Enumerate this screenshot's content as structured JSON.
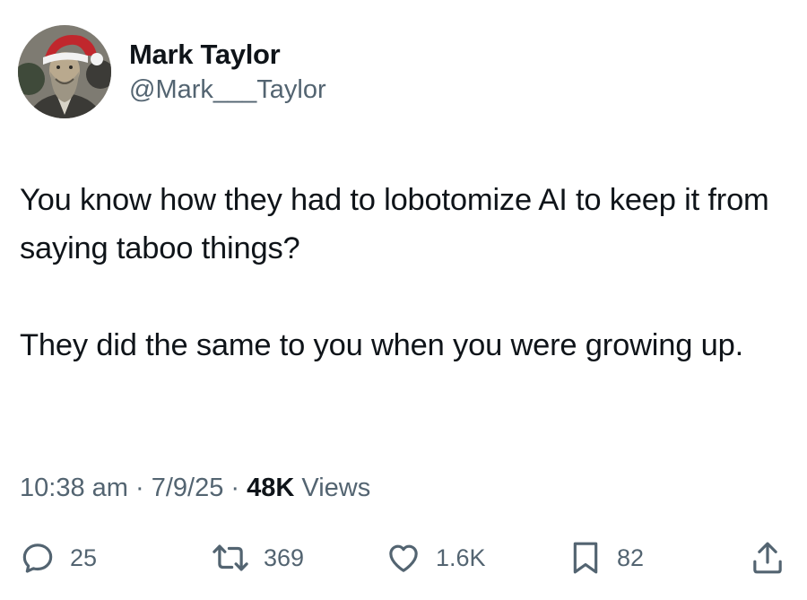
{
  "author": {
    "display_name": "Mark Taylor",
    "handle": "@Mark___Taylor",
    "avatar_icon": "avatar-portrait-santa-hat"
  },
  "tweet": {
    "paragraphs": [
      "You know how they had to lobotomize AI to keep it from saying taboo things?",
      "They did the same to you when you were growing up."
    ]
  },
  "meta": {
    "time": "10:38 am",
    "separator1": " · ",
    "date": "7/9/25",
    "separator2": " · ",
    "views_count": "48K",
    "views_label": " Views"
  },
  "actions": {
    "reply": {
      "icon": "reply-icon",
      "count": "25"
    },
    "retweet": {
      "icon": "retweet-icon",
      "count": "369"
    },
    "like": {
      "icon": "heart-icon",
      "count": "1.6K"
    },
    "bookmark": {
      "icon": "bookmark-icon",
      "count": "82"
    },
    "share": {
      "icon": "share-icon"
    }
  },
  "colors": {
    "text_primary": "#0f1419",
    "text_secondary": "#536471",
    "background": "#ffffff"
  }
}
